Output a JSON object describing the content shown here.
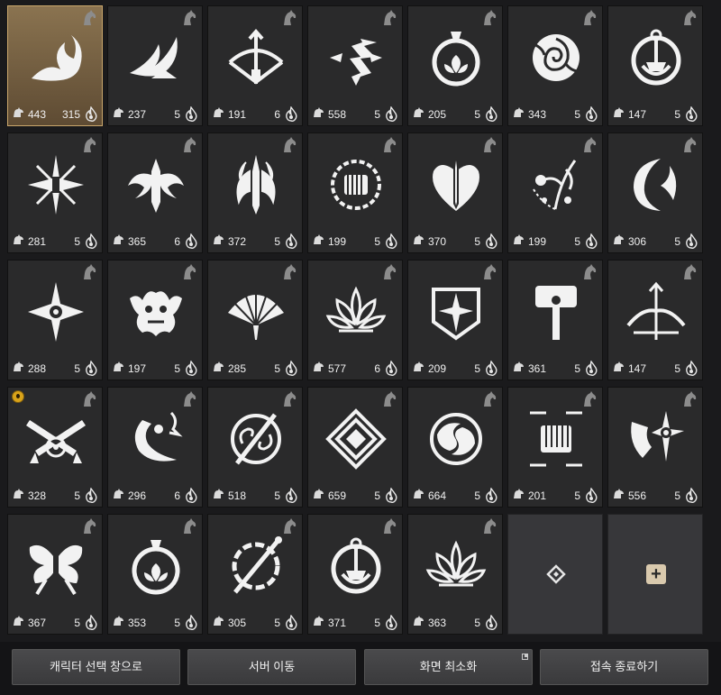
{
  "colors": {
    "panel_bg": "#1a1a1c",
    "slot_bg": "#2a2a2b",
    "selected_bg": "#7a6446",
    "selected_border": "#c9a66b",
    "accent_flame": "#e8e8e8",
    "badge": "#d9a31a"
  },
  "slots": [
    {
      "emblem": "wave-emblem-icon",
      "stat": "443",
      "level": "315",
      "selected": true
    },
    {
      "emblem": "wing-emblem-icon",
      "stat": "237",
      "level": "5"
    },
    {
      "emblem": "bow-emblem-icon",
      "stat": "191",
      "level": "6"
    },
    {
      "emblem": "lightning-cross-emblem-icon",
      "stat": "558",
      "level": "5"
    },
    {
      "emblem": "flask-emblem-icon",
      "stat": "205",
      "level": "5"
    },
    {
      "emblem": "rose-emblem-icon",
      "stat": "343",
      "level": "5"
    },
    {
      "emblem": "anchor-emblem-icon",
      "stat": "147",
      "level": "5"
    },
    {
      "emblem": "star-blade-emblem-icon",
      "stat": "281",
      "level": "5"
    },
    {
      "emblem": "winged-sword-emblem-icon",
      "stat": "365",
      "level": "6"
    },
    {
      "emblem": "flame-sword-emblem-icon",
      "stat": "372",
      "level": "5"
    },
    {
      "emblem": "fist-emblem-icon",
      "stat": "199",
      "level": "5"
    },
    {
      "emblem": "heart-sword-emblem-icon",
      "stat": "370",
      "level": "5"
    },
    {
      "emblem": "vine-emblem-icon",
      "stat": "199",
      "level": "5"
    },
    {
      "emblem": "crescent-emblem-icon",
      "stat": "306",
      "level": "5"
    },
    {
      "emblem": "shuriken-emblem-icon",
      "stat": "288",
      "level": "5"
    },
    {
      "emblem": "demon-emblem-icon",
      "stat": "197",
      "level": "5"
    },
    {
      "emblem": "fan-emblem-icon",
      "stat": "285",
      "level": "5"
    },
    {
      "emblem": "lotus-emblem-icon",
      "stat": "577",
      "level": "6"
    },
    {
      "emblem": "shield-star-emblem-icon",
      "stat": "209",
      "level": "5"
    },
    {
      "emblem": "hammer-emblem-icon",
      "stat": "361",
      "level": "5"
    },
    {
      "emblem": "crossbow-emblem-icon",
      "stat": "147",
      "level": "5"
    },
    {
      "emblem": "crossed-guns-emblem-icon",
      "stat": "328",
      "level": "5",
      "badge": true
    },
    {
      "emblem": "horn-emblem-icon",
      "stat": "296",
      "level": "6"
    },
    {
      "emblem": "spiral-sword-emblem-icon",
      "stat": "518",
      "level": "5"
    },
    {
      "emblem": "diamond-emblem-icon",
      "stat": "659",
      "level": "5"
    },
    {
      "emblem": "yin-yang-emblem-icon",
      "stat": "664",
      "level": "5"
    },
    {
      "emblem": "fist-frame-emblem-icon",
      "stat": "201",
      "level": "5"
    },
    {
      "emblem": "spiked-axe-emblem-icon",
      "stat": "556",
      "level": "5"
    },
    {
      "emblem": "butterfly-emblem-icon",
      "stat": "367",
      "level": "5"
    },
    {
      "emblem": "flask-emblem-icon",
      "stat": "353",
      "level": "5"
    },
    {
      "emblem": "flaming-staff-emblem-icon",
      "stat": "305",
      "level": "5"
    },
    {
      "emblem": "anchor-emblem-icon",
      "stat": "371",
      "level": "5"
    },
    {
      "emblem": "lotus-emblem-icon",
      "stat": "363",
      "level": "5"
    },
    {
      "empty": "diamond"
    },
    {
      "empty": "plus"
    }
  ],
  "buttons": {
    "character_select": "캐릭터 선택 창으로",
    "server_move": "서버 이동",
    "minimize": "화면 최소화",
    "exit": "접속 종료하기"
  }
}
